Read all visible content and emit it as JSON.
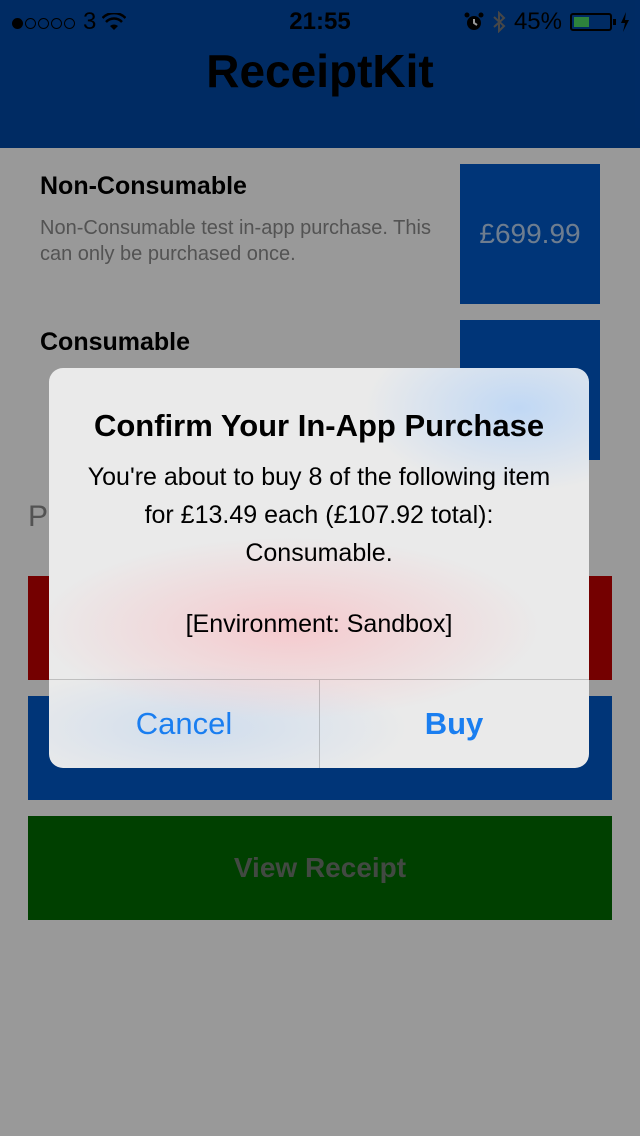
{
  "status_bar": {
    "signal_dots_filled": 1,
    "signal_dots_total": 5,
    "carrier": "3",
    "time": "21:55",
    "battery_percent": "45%",
    "battery_level": 0.45,
    "icons": [
      "wifi-icon",
      "alarm-icon",
      "bluetooth-icon",
      "battery-icon",
      "charging-icon"
    ]
  },
  "nav": {
    "title": "ReceiptKit"
  },
  "products": [
    {
      "name": "Non-Consumable",
      "description": "Non-Consumable test in-app purchase. This can only be purchased once.",
      "price": "£699.99"
    },
    {
      "name": "Consumable",
      "description": "",
      "price": ""
    }
  ],
  "section_label": "P",
  "buttons": {
    "red_label": "",
    "blue_label": "",
    "view_receipt": "View Receipt"
  },
  "alert": {
    "title": "Confirm Your In-App Purchase",
    "message": "You're about to buy 8 of the following item for £13.49 each (£107.92 total): Consumable.",
    "environment": "[Environment: Sandbox]",
    "cancel_label": "Cancel",
    "buy_label": "Buy"
  },
  "colors": {
    "nav_bg": "#0048a6",
    "price_bg": "#0059c9",
    "red_button": "#c10000",
    "green_button": "#006b00",
    "alert_button_text": "#1a7ef0"
  }
}
